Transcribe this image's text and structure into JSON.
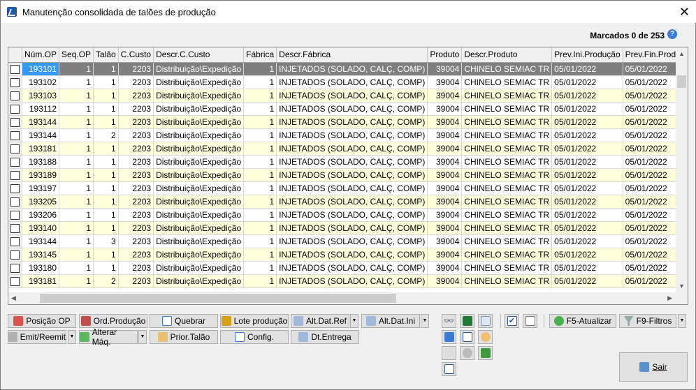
{
  "window": {
    "title": "Manutenção consolidada de talões de produção",
    "close": "✕"
  },
  "marked": "Marcados 0 de 253",
  "help": "?",
  "columns": [
    "Núm.OP",
    "Seq.OP",
    "Talão",
    "C.Custo",
    "Descr.C.Custo",
    "Fábrica",
    "Descr.Fábrica",
    "Produto",
    "Descr.Produto",
    "Prev.Ini.Produção",
    "Prev.Fin.Produção"
  ],
  "rows": [
    [
      "193101",
      "1",
      "1",
      "2203",
      "Distribuição\\Expedição",
      "1",
      "INJETADOS (SOLADO, CALÇ, COMP)",
      "39004",
      "CHINELO SEMIAC TR",
      "05/01/2022",
      "05/01/2022"
    ],
    [
      "193102",
      "1",
      "1",
      "2203",
      "Distribuição\\Expedição",
      "1",
      "INJETADOS (SOLADO, CALÇ, COMP)",
      "39004",
      "CHINELO SEMIAC TR",
      "05/01/2022",
      "05/01/2022"
    ],
    [
      "193103",
      "1",
      "1",
      "2203",
      "Distribuição\\Expedição",
      "1",
      "INJETADOS (SOLADO, CALÇ, COMP)",
      "39004",
      "CHINELO SEMIAC TR",
      "05/01/2022",
      "05/01/2022"
    ],
    [
      "193112",
      "1",
      "1",
      "2203",
      "Distribuição\\Expedição",
      "1",
      "INJETADOS (SOLADO, CALÇ, COMP)",
      "39004",
      "CHINELO SEMIAC TR",
      "05/01/2022",
      "05/01/2022"
    ],
    [
      "193144",
      "1",
      "1",
      "2203",
      "Distribuição\\Expedição",
      "1",
      "INJETADOS (SOLADO, CALÇ, COMP)",
      "39004",
      "CHINELO SEMIAC TR",
      "05/01/2022",
      "05/01/2022"
    ],
    [
      "193144",
      "1",
      "2",
      "2203",
      "Distribuição\\Expedição",
      "1",
      "INJETADOS (SOLADO, CALÇ, COMP)",
      "39004",
      "CHINELO SEMIAC TR",
      "05/01/2022",
      "05/01/2022"
    ],
    [
      "193181",
      "1",
      "1",
      "2203",
      "Distribuição\\Expedição",
      "1",
      "INJETADOS (SOLADO, CALÇ, COMP)",
      "39004",
      "CHINELO SEMIAC TR",
      "05/01/2022",
      "05/01/2022"
    ],
    [
      "193188",
      "1",
      "1",
      "2203",
      "Distribuição\\Expedição",
      "1",
      "INJETADOS (SOLADO, CALÇ, COMP)",
      "39004",
      "CHINELO SEMIAC TR",
      "05/01/2022",
      "05/01/2022"
    ],
    [
      "193189",
      "1",
      "1",
      "2203",
      "Distribuição\\Expedição",
      "1",
      "INJETADOS (SOLADO, CALÇ, COMP)",
      "39004",
      "CHINELO SEMIAC TR",
      "05/01/2022",
      "05/01/2022"
    ],
    [
      "193197",
      "1",
      "1",
      "2203",
      "Distribuição\\Expedição",
      "1",
      "INJETADOS (SOLADO, CALÇ, COMP)",
      "39004",
      "CHINELO SEMIAC TR",
      "05/01/2022",
      "05/01/2022"
    ],
    [
      "193205",
      "1",
      "1",
      "2203",
      "Distribuição\\Expedição",
      "1",
      "INJETADOS (SOLADO, CALÇ, COMP)",
      "39004",
      "CHINELO SEMIAC TR",
      "05/01/2022",
      "05/01/2022"
    ],
    [
      "193206",
      "1",
      "1",
      "2203",
      "Distribuição\\Expedição",
      "1",
      "INJETADOS (SOLADO, CALÇ, COMP)",
      "39004",
      "CHINELO SEMIAC TR",
      "05/01/2022",
      "05/01/2022"
    ],
    [
      "193140",
      "1",
      "1",
      "2203",
      "Distribuição\\Expedição",
      "1",
      "INJETADOS (SOLADO, CALÇ, COMP)",
      "39004",
      "CHINELO SEMIAC TR",
      "05/01/2022",
      "05/01/2022"
    ],
    [
      "193144",
      "1",
      "3",
      "2203",
      "Distribuição\\Expedição",
      "1",
      "INJETADOS (SOLADO, CALÇ, COMP)",
      "39004",
      "CHINELO SEMIAC TR",
      "05/01/2022",
      "05/01/2022"
    ],
    [
      "193145",
      "1",
      "1",
      "2203",
      "Distribuição\\Expedição",
      "1",
      "INJETADOS (SOLADO, CALÇ, COMP)",
      "39004",
      "CHINELO SEMIAC TR",
      "05/01/2022",
      "05/01/2022"
    ],
    [
      "193180",
      "1",
      "1",
      "2203",
      "Distribuição\\Expedição",
      "1",
      "INJETADOS (SOLADO, CALÇ, COMP)",
      "39004",
      "CHINELO SEMIAC TR",
      "05/01/2022",
      "05/01/2022"
    ],
    [
      "193181",
      "1",
      "2",
      "2203",
      "Distribuição\\Expedição",
      "1",
      "INJETADOS (SOLADO, CALÇ, COMP)",
      "39004",
      "CHINELO SEMIAC TR",
      "05/01/2022",
      "05/01/2022"
    ]
  ],
  "buttons": {
    "posicao": "Posição OP",
    "ordprod": "Ord.Produção",
    "quebrar": "Quebrar",
    "lote": "Lote produção",
    "altref": "Alt.Dat.Ref",
    "altini": "Alt.Dat.Ini",
    "emit": "Emit/Reemit",
    "altmaq": "Alterar Máq.",
    "prior": "Prior.Talão",
    "config": "Config.",
    "dtent": "Dt.Entrega",
    "atualizar": "F5-Atualizar",
    "filtros": "F9-Filtros",
    "sair": "Sair"
  }
}
